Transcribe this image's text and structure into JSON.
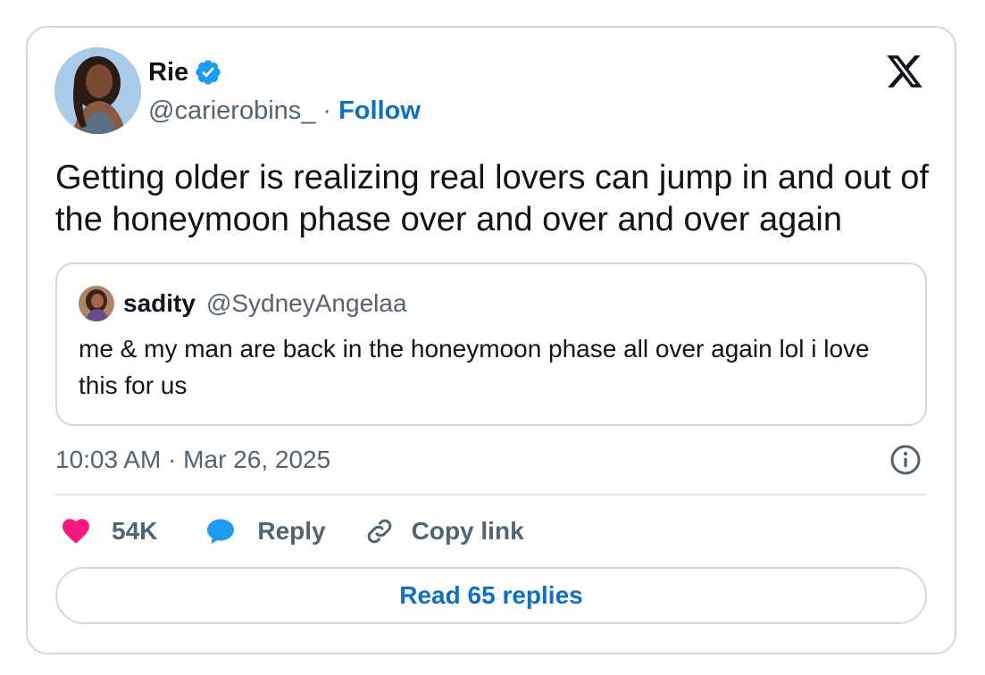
{
  "author": {
    "name": "Rie",
    "handle": "@carierobins_",
    "separator": "·",
    "follow_label": "Follow",
    "verified": true
  },
  "tweet": {
    "text": "Getting older is realizing real lovers can jump in and out of the honeymoon phase over and over and over again",
    "timestamp": "10:03 AM · Mar 26, 2025"
  },
  "quote": {
    "name": "sadity",
    "handle": "@SydneyAngelaa",
    "text": "me & my man are back in the honeymoon phase all over again lol i love this for us"
  },
  "actions": {
    "likes": "54K",
    "reply_label": "Reply",
    "copy_link_label": "Copy link"
  },
  "read_replies_label": "Read 65 replies",
  "icons": {
    "platform": "x-logo-icon",
    "verified": "verified-badge-icon",
    "like": "heart-icon",
    "reply": "speech-bubble-icon",
    "copy": "link-icon",
    "info": "info-icon"
  },
  "colors": {
    "accent": "#0f6fc5",
    "verified": "#1d9bf0",
    "heart": "#f91880",
    "reply": "#1d9bf0",
    "text": "#0f1419",
    "muted": "#536471",
    "border": "#cfd9de"
  }
}
